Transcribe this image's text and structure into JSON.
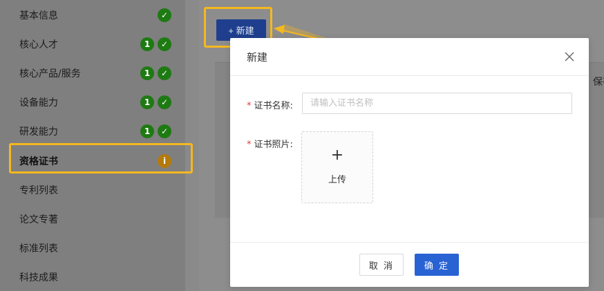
{
  "sidebar": {
    "items": [
      {
        "label": "基本信息",
        "status": "check"
      },
      {
        "label": "核心人才",
        "status": "count",
        "count": "1"
      },
      {
        "label": "核心产品/服务",
        "status": "count",
        "count": "1"
      },
      {
        "label": "设备能力",
        "status": "count",
        "count": "1"
      },
      {
        "label": "研发能力",
        "status": "count",
        "count": "1"
      },
      {
        "label": "资格证书",
        "status": "warning",
        "warning_glyph": "i"
      },
      {
        "label": "专利列表",
        "status": "none"
      },
      {
        "label": "论文专著",
        "status": "none"
      },
      {
        "label": "标准列表",
        "status": "none"
      },
      {
        "label": "科技成果",
        "status": "none"
      }
    ],
    "check_glyph": "✓",
    "active_index": 5
  },
  "toolbar": {
    "new_button_label": "+ 新建"
  },
  "table": {
    "header_fragment": "保存"
  },
  "modal": {
    "title": "新建",
    "close_glyph": "×",
    "fields": {
      "cert_name": {
        "required_mark": "*",
        "label": "证书名称:",
        "placeholder": "请输入证书名称",
        "value": ""
      },
      "cert_photo": {
        "required_mark": "*",
        "label": "证书照片:",
        "upload_plus": "+",
        "upload_label": "上传"
      }
    },
    "footer": {
      "cancel_label": "取 消",
      "ok_label": "确 定"
    }
  },
  "colors": {
    "highlight": "#f6b81f",
    "primary": "#2962d3",
    "success": "#1e7a12",
    "warning": "#b37a0c",
    "required": "#e23b3b"
  }
}
